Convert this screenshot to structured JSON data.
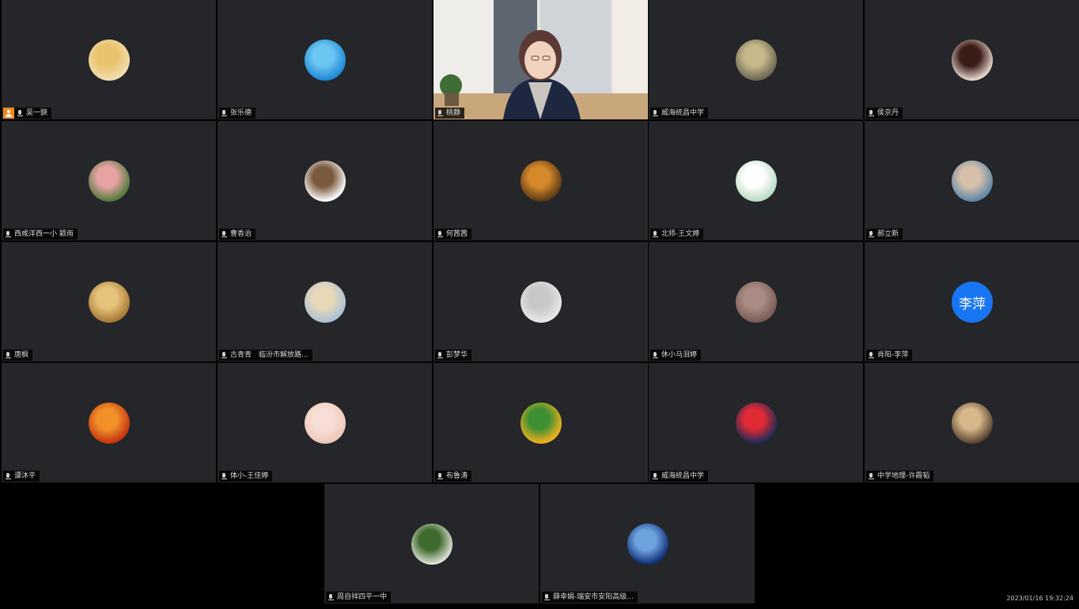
{
  "timestamp": "2023/01/16 19:32:24",
  "participants": [
    {
      "name": "吴一鋏",
      "host": true,
      "avatar": {
        "bg": "#f1dfb0",
        "fg": "#e9c26e"
      }
    },
    {
      "name": "张乐德",
      "avatar": {
        "bg": "#1e88d6",
        "fg": "#6cc6f2"
      }
    },
    {
      "name": "桃静",
      "video": true
    },
    {
      "name": "威海统昌中学",
      "avatar": {
        "bg": "#6c6651",
        "fg": "#c5b98a"
      }
    },
    {
      "name": "侯京丹",
      "avatar": {
        "bg": "#e8d9cf",
        "fg": "#3a1c17"
      }
    },
    {
      "name": "西咸洋西一小 颖雨",
      "avatar": {
        "bg": "#4f7a3b",
        "fg": "#e7a2a3"
      }
    },
    {
      "name": "曹香治",
      "avatar": {
        "bg": "#ffffff",
        "fg": "#7b5b40"
      }
    },
    {
      "name": "何茜茜",
      "avatar": {
        "bg": "#5a3a15",
        "fg": "#d5892b"
      }
    },
    {
      "name": "北师-王文婷",
      "avatar": {
        "bg": "#b9dcc2",
        "fg": "#ffffff"
      }
    },
    {
      "name": "郝立新",
      "avatar": {
        "bg": "#5d86a8",
        "fg": "#d6c0aa"
      }
    },
    {
      "name": "唐枫",
      "avatar": {
        "bg": "#a67837",
        "fg": "#e6c37a"
      }
    },
    {
      "name": "古青青　临汾市解放路...",
      "avatar": {
        "bg": "#a8c1d6",
        "fg": "#e9d8b8"
      }
    },
    {
      "name": "彭梦华",
      "avatar": {
        "bg": "#e8e8e8",
        "fg": "#c7c7c7"
      }
    },
    {
      "name": "休小马泪婷",
      "avatar": {
        "bg": "#7a5c56",
        "fg": "#a98b84"
      }
    },
    {
      "name": "肖阳-李萍",
      "avatar": {
        "bg": "#1976f2",
        "fg": "#ffffff"
      },
      "avatar_text": "李萍"
    },
    {
      "name": "谭沐平",
      "avatar": {
        "bg": "#c23410",
        "fg": "#f2912a"
      }
    },
    {
      "name": "体小-王佳婷",
      "avatar": {
        "bg": "#efc6b8",
        "fg": "#f7dfd6"
      }
    },
    {
      "name": "布魯涛",
      "avatar": {
        "bg": "#f3b01d",
        "fg": "#3c8f33"
      }
    },
    {
      "name": "威海统昌中学",
      "avatar": {
        "bg": "#1f2a57",
        "fg": "#e02a35"
      }
    },
    {
      "name": "中学地理-许霞韬",
      "avatar": {
        "bg": "#5a4430",
        "fg": "#d7b88a"
      }
    },
    {
      "name": "周自祥四平一中",
      "avatar": {
        "bg": "#dfe4d8",
        "fg": "#3f6a2d"
      }
    },
    {
      "name": "薛幸娟-瑞安市安阳高级...",
      "avatar": {
        "bg": "#0f2e76",
        "fg": "#6fa3e0"
      }
    }
  ]
}
